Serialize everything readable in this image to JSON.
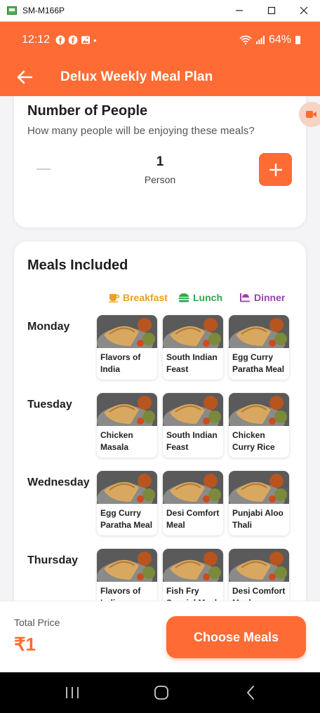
{
  "window": {
    "title": "SM-M166P"
  },
  "status_bar": {
    "time": "12:12",
    "battery": "64%",
    "dot": "•"
  },
  "app_bar": {
    "title": "Delux Weekly Meal Plan"
  },
  "people_card": {
    "heading": "Number of People",
    "question": "How many people will be enjoying these meals?",
    "count": "1",
    "unit": "Person"
  },
  "meals_card": {
    "heading": "Meals Included",
    "legend": {
      "breakfast": "Breakfast",
      "lunch": "Lunch",
      "dinner": "Dinner"
    },
    "days": [
      {
        "name": "Monday",
        "meals": [
          "Flavors of India Break…",
          "South Indian Feast",
          "Egg Curry Paratha Meal"
        ]
      },
      {
        "name": "Tuesday",
        "meals": [
          "Chicken Masala Bhu…",
          "South Indian Feast",
          "Chicken Curry Rice …"
        ]
      },
      {
        "name": "Wednesday",
        "meals": [
          "Egg Curry Paratha Meal",
          "Desi Comfort Meal",
          "Punjabi Aloo Thali"
        ]
      },
      {
        "name": "Thursday",
        "meals": [
          "Flavors of India Break…",
          "Fish Fry Special Meal",
          "Desi Comfort Meal"
        ]
      }
    ]
  },
  "footer": {
    "total_label": "Total Price",
    "total_value": "₹1",
    "cta": "Choose Meals"
  },
  "colors": {
    "accent": "#ff6b35",
    "breakfast": "#f0a020",
    "lunch": "#30a84b",
    "dinner": "#9c3fb0"
  }
}
